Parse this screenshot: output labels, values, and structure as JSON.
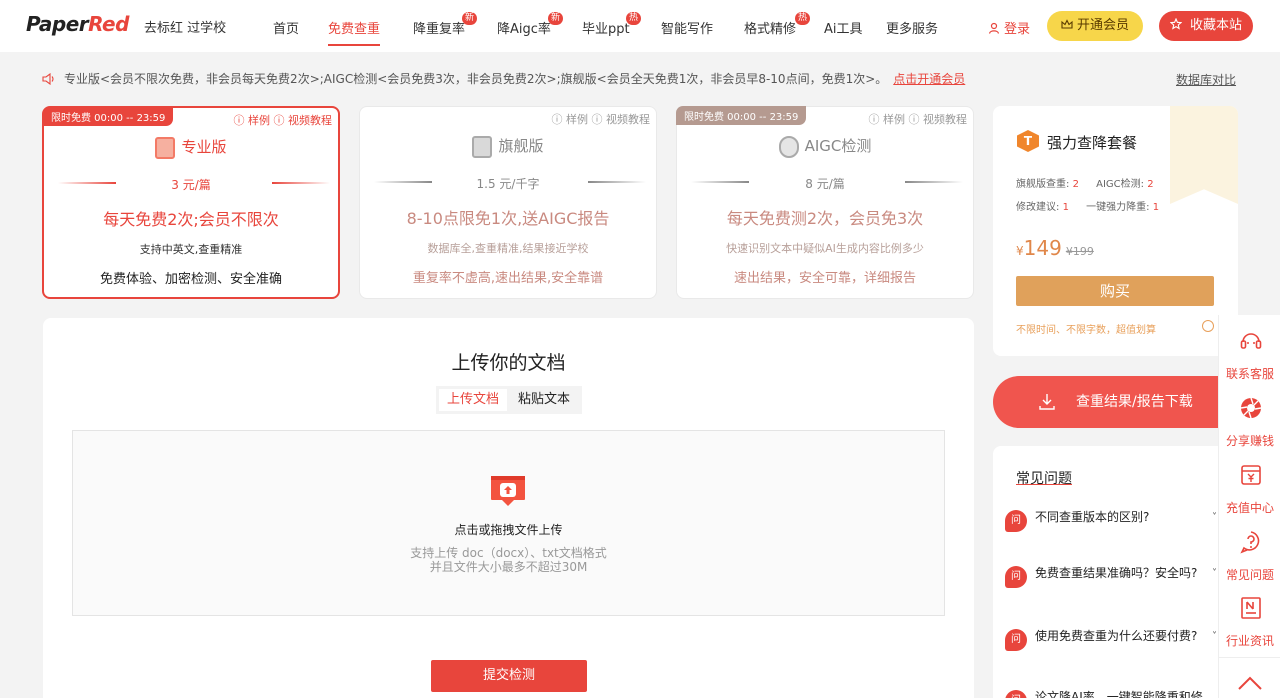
{
  "header": {
    "logo_dark": "Paper",
    "logo_red": "Red",
    "tagline": "去标红 过学校",
    "nav": [
      {
        "label": "首页",
        "badge": ""
      },
      {
        "label": "免费查重",
        "badge": ""
      },
      {
        "label": "降重复率",
        "badge": "新"
      },
      {
        "label": "降Aigc率",
        "badge": "新"
      },
      {
        "label": "毕业ppt",
        "badge": "热"
      },
      {
        "label": "智能写作",
        "badge": ""
      },
      {
        "label": "格式精修",
        "badge": "热"
      },
      {
        "label": "Ai工具",
        "badge": ""
      },
      {
        "label": "更多服务",
        "badge": ""
      }
    ],
    "active_index": 1,
    "login": "登录",
    "vip_button": "开通会员",
    "fav_button": "收藏本站"
  },
  "notice": {
    "text": "专业版<会员不限次免费，非会员每天免费2次>;AIGC检测<会员免费3次，非会员免费2次>;旗舰版<会员全天免费1次，非会员早8-10点间，免费1次>。",
    "link": "点击开通会员",
    "db_compare": "数据库对比"
  },
  "cards": [
    {
      "tag": "限时免费 00:00 -- 23:59",
      "links": "ⓘ 样例 ⓘ 视频教程",
      "title": "专业版",
      "price": "3 元/篇",
      "main": "每天免费2次;会员不限次",
      "sub": "支持中英文,查重精准",
      "feat": "免费体验、加密检测、安全准确"
    },
    {
      "tag": "",
      "links": "ⓘ 样例 ⓘ 视频教程",
      "title": "旗舰版",
      "price": "1.5 元/千字",
      "main": "8-10点限免1次,送AIGC报告",
      "sub": "数据库全,查重精准,结果接近学校",
      "feat": "重复率不虚高,速出结果,安全靠谱"
    },
    {
      "tag": "限时免费 00:00 -- 23:59",
      "links": "ⓘ 样例 ⓘ 视频教程",
      "title": "AIGC检测",
      "price": "8 元/篇",
      "main": "每天免费测2次，会员免3次",
      "sub": "快速识别文本中疑似AI生成内容比例多少",
      "feat": "速出结果，安全可靠，详细报告"
    }
  ],
  "upload": {
    "title": "上传你的文档",
    "tab_upload": "上传文档",
    "tab_paste": "粘贴文本",
    "drop_label": "点击或拖拽文件上传",
    "hint_line1": "支持上传 doc（docx）、txt文档格式",
    "hint_line2": "并且文件大小最多不超过30M",
    "submit": "提交检测"
  },
  "package": {
    "logo_letter": "T",
    "title": "强力查降套餐",
    "spec1_label": "旗舰版查重:",
    "spec1_value": "2",
    "spec2_label": "AIGC检测:",
    "spec2_value": "2",
    "spec3_label": "修改建议:",
    "spec3_value": "1",
    "spec4_label": "一键强力降重:",
    "spec4_value": "1",
    "currency": "¥",
    "price": "149",
    "old_price": "¥199",
    "buy": "购买",
    "note": "不限时间、不限字数，超值划算"
  },
  "download": {
    "label": "查重结果/报告下载"
  },
  "faq": {
    "title": "常见问题",
    "q_icon": "问",
    "items": [
      "不同查重版本的区别?",
      "免费查重结果准确吗？安全吗?",
      "使用免费查重为什么还要付费?",
      "论文降AI率，一键智能降重和修"
    ]
  },
  "sidebar": [
    {
      "label": "联系客服",
      "icon": "headset-icon"
    },
    {
      "label": "分享赚钱",
      "icon": "aperture-icon"
    },
    {
      "label": "充值中心",
      "icon": "yen-icon"
    },
    {
      "label": "常见问题",
      "icon": "question-icon"
    },
    {
      "label": "行业资讯",
      "icon": "news-icon"
    }
  ],
  "colors": {
    "accent": "#e8453c",
    "vip": "#f7d64a",
    "gold": "#e0a15b"
  }
}
